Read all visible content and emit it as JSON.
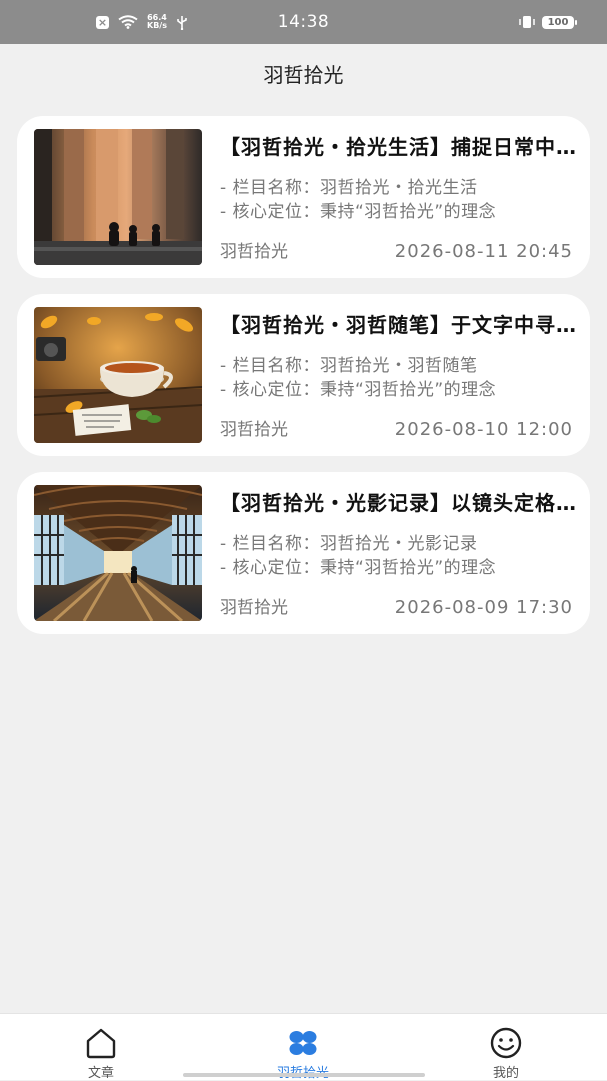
{
  "status_bar": {
    "network_speed_value": "66.4",
    "network_speed_unit": "KB/s",
    "time": "14:38",
    "battery": "100",
    "icons": [
      "notification-x-icon",
      "wifi-icon",
      "usb-icon",
      "vibrate-icon",
      "battery-icon"
    ]
  },
  "header": {
    "title": "羽哲拾光"
  },
  "articles": [
    {
      "title": "【羽哲拾光・拾光生活】捕捉日常中的温暖瞬间",
      "column_line": "- 栏目名称：羽哲拾光・拾光生活",
      "position_line": "- 核心定位：秉持“羽哲拾光”的理念",
      "author": "羽哲拾光",
      "date": "2026-08-11 20:45"
    },
    {
      "title": "【羽哲拾光・羽哲随笔】于文字中寻找心灵栖息",
      "column_line": "- 栏目名称：羽哲拾光・羽哲随笔",
      "position_line": "- 核心定位：秉持“羽哲拾光”的理念",
      "author": "羽哲拾光",
      "date": "2026-08-10 12:00"
    },
    {
      "title": "【羽哲拾光・光影记录】以镜头定格时光",
      "column_line": "- 栏目名称：羽哲拾光・光影记录",
      "position_line": "- 核心定位：秉持“羽哲拾光”的理念",
      "author": "羽哲拾光",
      "date": "2026-08-09 17:30"
    }
  ],
  "bottom_nav": {
    "items": [
      {
        "label": "文章",
        "icon": "home-outline-icon",
        "active": false
      },
      {
        "label": "羽哲拾光",
        "icon": "four-petal-icon",
        "active": true
      },
      {
        "label": "我的",
        "icon": "smiley-icon",
        "active": false
      }
    ]
  },
  "colors": {
    "accent": "#2b7de0",
    "status_bar": "#8c8c8c",
    "background": "#f0f0f0"
  }
}
